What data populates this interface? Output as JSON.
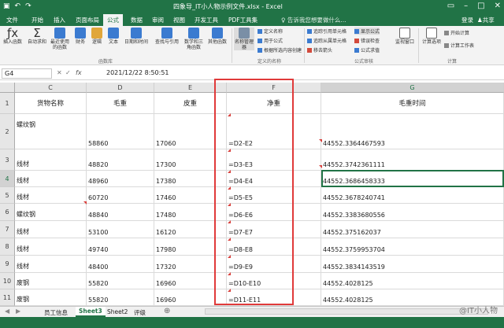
{
  "window": {
    "title": "四象导_IT小人物示例文件.xlsx - Excel"
  },
  "menu": {
    "tabs": [
      "文件",
      "开始",
      "插入",
      "页面布局",
      "公式",
      "数据",
      "审阅",
      "视图",
      "开发工具",
      "PDF工具集"
    ],
    "active": "公式",
    "tell_me": "告诉我您想要做什么...",
    "account": "登录",
    "share": "共享"
  },
  "ribbon": {
    "groups": {
      "function_library": "函数库",
      "defined_names": "定义的名称",
      "formula_auditing": "公式审核",
      "calculation": "计算"
    },
    "buttons": {
      "insert_function": "插入函数",
      "autosum": "自动求和",
      "recent": "最近使用的函数",
      "financial": "财务",
      "logical": "逻辑",
      "text": "文本",
      "datetime": "日期和时间",
      "lookup": "查找与引用",
      "math": "数学和三角函数",
      "more": "其他函数",
      "name_manager": "名称管理器",
      "define_name": "定义名称",
      "use_in_formula": "用于公式",
      "create_from_selection": "根据所选内容创建",
      "trace_precedents": "追踪引用单元格",
      "trace_dependents": "追踪从属单元格",
      "remove_arrows": "移去箭头",
      "show_formulas": "显示公式",
      "error_checking": "错误检查",
      "evaluate_formula": "公式求值",
      "watch_window": "监视窗口",
      "calc_options": "计算选项",
      "calc_now": "开始计算",
      "calc_sheet": "计算工作表"
    }
  },
  "formula_bar": {
    "name_box": "G4",
    "fx": "fx",
    "content": "2021/12/22  8:50:51"
  },
  "columns": [
    "C",
    "D",
    "E",
    "F",
    "G"
  ],
  "header_row": {
    "row": "1",
    "cells": [
      "货物名称",
      "毛重",
      "皮重",
      "净重",
      "毛重时间"
    ]
  },
  "rows": [
    {
      "row": "2",
      "cells": [
        "螺纹钢",
        "58860",
        "17060",
        "=D2-E2",
        "44552.3364467593"
      ]
    },
    {
      "row": "3",
      "cells": [
        "线材",
        "48820",
        "17300",
        "=D3-E3",
        "44552.3742361111"
      ]
    },
    {
      "row": "4",
      "cells": [
        "线材",
        "48960",
        "17380",
        "=D4-E4",
        "44552.3686458333"
      ]
    },
    {
      "row": "5",
      "cells": [
        "线材",
        "60720",
        "17460",
        "=D5-E5",
        "44552.3678240741"
      ]
    },
    {
      "row": "6",
      "cells": [
        "螺纹钢",
        "48840",
        "17480",
        "=D6-E6",
        "44552.3383680556"
      ]
    },
    {
      "row": "7",
      "cells": [
        "线材",
        "53100",
        "16120",
        "=D7-E7",
        "44552.375162037"
      ]
    },
    {
      "row": "8",
      "cells": [
        "线材",
        "49740",
        "17980",
        "=D8-E8",
        "44552.3759953704"
      ]
    },
    {
      "row": "9",
      "cells": [
        "线材",
        "48400",
        "17320",
        "=D9-E9",
        "44552.3834143519"
      ]
    },
    {
      "row": "10",
      "cells": [
        "废钢",
        "55820",
        "16960",
        "=D10-E10",
        "44552.4028125"
      ]
    },
    {
      "row": "11",
      "cells": [
        "废钢",
        "55820",
        "16960",
        "=D11-E11",
        "44552.4028125"
      ]
    }
  ],
  "sheets": {
    "tabs": [
      "员工信息",
      "Sheet3",
      "Sheet2",
      "评级"
    ],
    "active": "Sheet3"
  },
  "watermark": "@IT小人物",
  "colors": {
    "excel_green": "#217346",
    "highlight_red": "#e03a3a"
  }
}
